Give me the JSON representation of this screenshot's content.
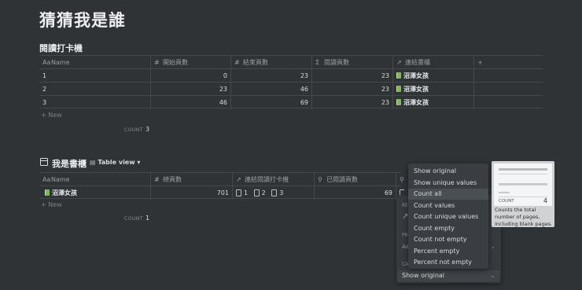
{
  "page_title": "猜猜我是誰",
  "table1": {
    "title": "閱讀打卡機",
    "columns": [
      {
        "icon": "Aa",
        "label": "Name"
      },
      {
        "icon": "#",
        "label": "開始頁數"
      },
      {
        "icon": "#",
        "label": "結束頁數"
      },
      {
        "icon": "Σ",
        "label": "閱讀頁數"
      },
      {
        "icon": "↗",
        "label": "連結書櫃"
      },
      {
        "icon": "+",
        "label": ""
      }
    ],
    "rows": [
      {
        "name": "1",
        "start": "0",
        "end": "23",
        "read": "23",
        "link": "沼澤女孩"
      },
      {
        "name": "2",
        "start": "23",
        "end": "46",
        "read": "23",
        "link": "沼澤女孩"
      },
      {
        "name": "3",
        "start": "46",
        "end": "69",
        "read": "23",
        "link": "沼澤女孩"
      }
    ],
    "new_label": "+ New",
    "count_label": "COUNT",
    "count_value": "3"
  },
  "table2": {
    "title": "我是書櫃",
    "view_label": "Table view",
    "columns": [
      {
        "icon": "Aa",
        "label": "Name"
      },
      {
        "icon": "#",
        "label": "總頁數"
      },
      {
        "icon": "↗",
        "label": "連結閱讀打卡機"
      },
      {
        "icon": "⚲",
        "label": "已閱讀頁數"
      },
      {
        "icon": "⚲",
        "label": ""
      }
    ],
    "rows": [
      {
        "name": "沼澤女孩",
        "total": "701",
        "links": [
          "1",
          "2",
          "3"
        ],
        "read": "69"
      }
    ],
    "new_label": "+ New",
    "count_label": "COUNT",
    "count_value": "1"
  },
  "property_panel": {
    "partial_labels": [
      "RE",
      "PR",
      "CA"
    ],
    "calc_value": "Show original"
  },
  "dropdown": {
    "items": [
      "Show original",
      "Show unique values",
      "Count all",
      "Count values",
      "Count unique values",
      "Count empty",
      "Count not empty",
      "Percent empty",
      "Percent not empty"
    ],
    "selected_index": 2
  },
  "tooltip": {
    "count_label": "COUNT",
    "count_value": "4",
    "description": "Counts the total number of pages, including blank pages."
  }
}
